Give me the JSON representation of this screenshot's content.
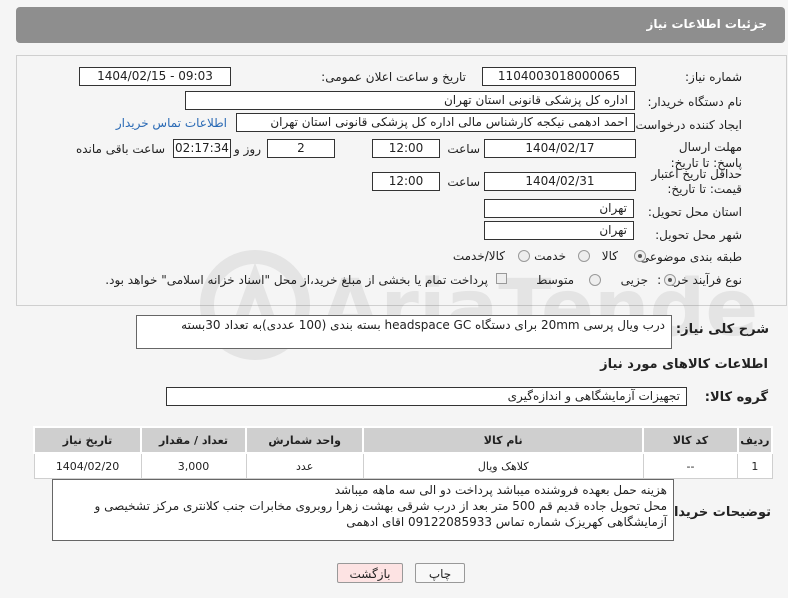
{
  "header": {
    "title": "جزئیات اطلاعات نیاز"
  },
  "need_number": {
    "label": "شماره نیاز:",
    "value": "1104003018000065"
  },
  "announce": {
    "label": "تاریخ و ساعت اعلان عمومی:",
    "value": "1404/02/15 - 09:03"
  },
  "buyer": {
    "label": "نام دستگاه خریدار:",
    "value": "اداره کل پزشکی قانونی استان تهران"
  },
  "creator": {
    "label": "ایجاد کننده درخواست:",
    "value": "احمد ادهمی نیکجه کارشناس مالی اداره کل پزشکی قانونی استان تهران",
    "contact_link": "اطلاعات تماس خریدار"
  },
  "deadline": {
    "label": "مهلت ارسال پاسخ: تا تاریخ:",
    "date": "1404/02/17",
    "time_label": "ساعت",
    "time": "12:00",
    "days": "2",
    "days_label": "روز و",
    "remaining": "02:17:34",
    "remaining_label": "ساعت باقی مانده"
  },
  "validity": {
    "label": "حداقل تاریخ اعتبار قیمت: تا تاریخ:",
    "date": "1404/02/31",
    "time_label": "ساعت",
    "time": "12:00"
  },
  "province": {
    "label": "استان محل تحویل:",
    "value": "تهران"
  },
  "city": {
    "label": "شهر محل تحویل:",
    "value": "تهران"
  },
  "category": {
    "label": "طبقه بندی موضوعی:",
    "options": [
      "کالا",
      "خدمت",
      "کالا/خدمت"
    ],
    "selected": "کالا"
  },
  "process": {
    "label": "نوع فرآیند خرید :",
    "options": [
      "جزیی",
      "متوسط"
    ],
    "selected": "جزیی",
    "note": "پرداخت تمام یا بخشی از مبلغ خرید،از محل \"اسناد خزانه اسلامی\" خواهد بود."
  },
  "description": {
    "label": "شرح کلی نیاز:",
    "value": "درب ویال پرسی 20mm برای دستگاه headspace GC بسته بندی (100 عددی)به تعداد 30بسته"
  },
  "goods_section": {
    "title": "اطلاعات کالاهای مورد نیاز"
  },
  "goods_group": {
    "label": "گروه کالا:",
    "value": "تجهیزات آزمایشگاهی و اندازه‌گیری"
  },
  "table": {
    "headers": [
      "ردیف",
      "کد کالا",
      "نام کالا",
      "واحد شمارش",
      "تعداد / مقدار",
      "تاریخ نیاز"
    ],
    "rows": [
      [
        "1",
        "--",
        "کلاهک ویال",
        "عدد",
        "3,000",
        "1404/02/20"
      ]
    ]
  },
  "buyer_notes": {
    "label": "توضیحات خریدار:",
    "lines": [
      "هزینه حمل بعهده فروشنده میباشد پرداخت دو الی سه ماهه میباشد",
      "محل تحویل جاده قدیم قم 500 متر بعد از درب شرقی بهشت زهرا روبروی مخابرات جنب کلانتری مرکز تشخیصی و",
      "آزمایشگاهی کهریزک شماره تماس 09122085933 اقای ادهمی"
    ]
  },
  "buttons": {
    "print": "چاپ",
    "back": "بازگشت"
  },
  "colors": {
    "header_bg": "#8e8e8e",
    "back_button_bg": "#fde3e3",
    "link": "#2a6ab5"
  }
}
